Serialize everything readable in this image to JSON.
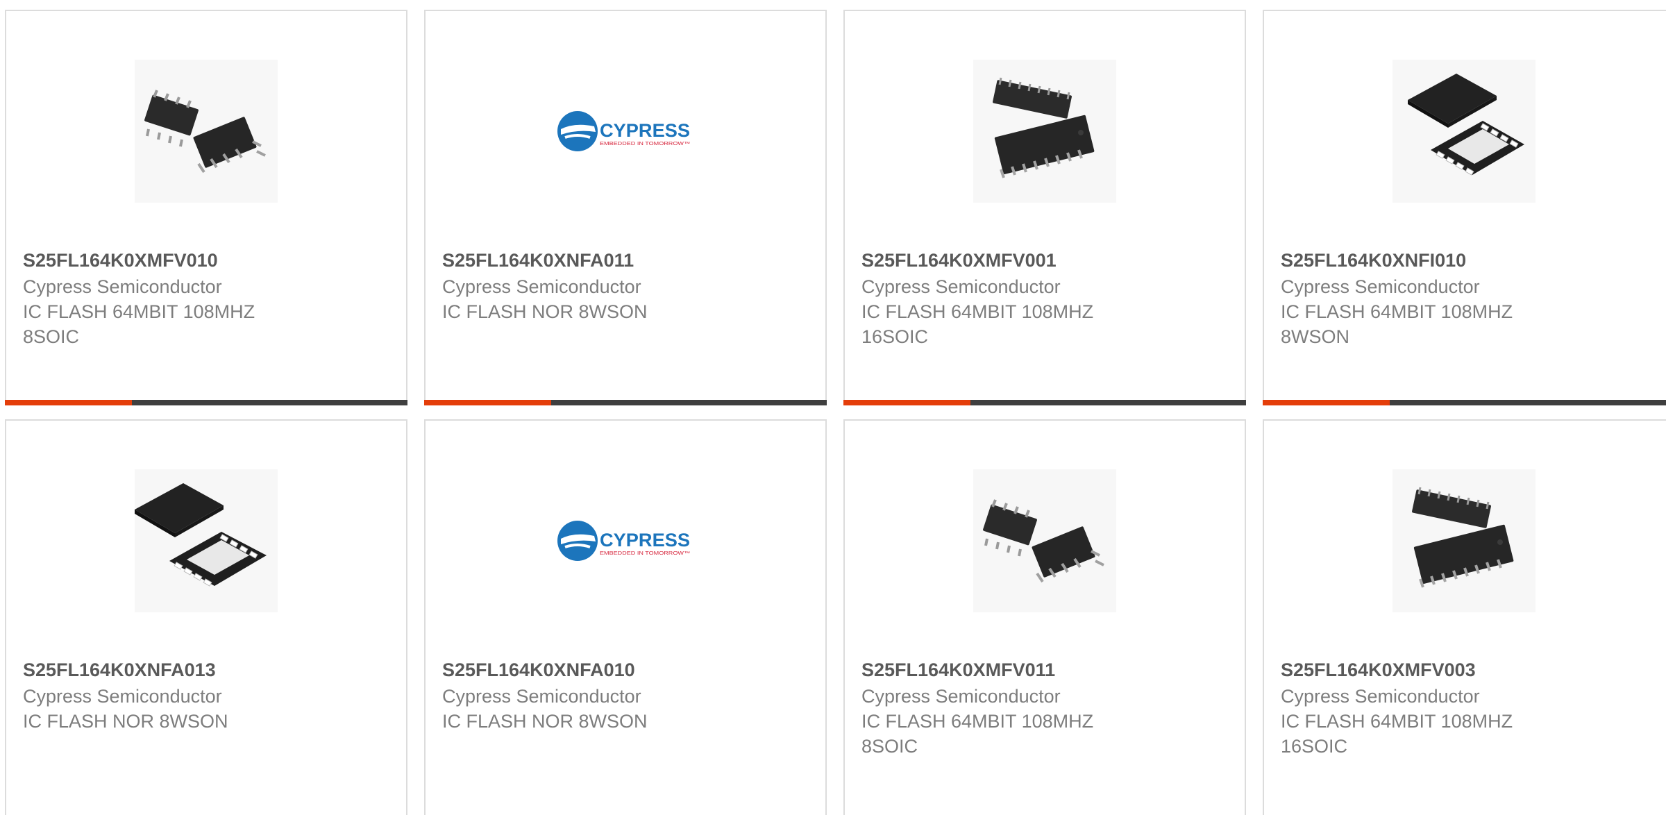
{
  "products": [
    {
      "part_number": "S25FL164K0XMFV010",
      "manufacturer": "Cypress Semiconductor",
      "description": "IC FLASH 64MBIT 108MHZ 8SOIC",
      "image": "chip-8soic-icon"
    },
    {
      "part_number": "S25FL164K0XNFA011",
      "manufacturer": "Cypress Semiconductor",
      "description": "IC FLASH NOR 8WSON",
      "image": "cypress-logo"
    },
    {
      "part_number": "S25FL164K0XMFV001",
      "manufacturer": "Cypress Semiconductor",
      "description": "IC FLASH 64MBIT 108MHZ 16SOIC",
      "image": "chip-16soic-icon"
    },
    {
      "part_number": "S25FL164K0XNFI010",
      "manufacturer": "Cypress Semiconductor",
      "description": "IC FLASH 64MBIT 108MHZ 8WSON",
      "image": "chip-8wson-icon"
    },
    {
      "part_number": "S25FL164K0XNFA013",
      "manufacturer": "Cypress Semiconductor",
      "description": "IC FLASH NOR 8WSON",
      "image": "chip-8wson-icon"
    },
    {
      "part_number": "S25FL164K0XNFA010",
      "manufacturer": "Cypress Semiconductor",
      "description": "IC FLASH NOR 8WSON",
      "image": "cypress-logo"
    },
    {
      "part_number": "S25FL164K0XMFV011",
      "manufacturer": "Cypress Semiconductor",
      "description": "IC FLASH 64MBIT 108MHZ 8SOIC",
      "image": "chip-8soic-icon"
    },
    {
      "part_number": "S25FL164K0XMFV003",
      "manufacturer": "Cypress Semiconductor",
      "description": "IC FLASH 64MBIT 108MHZ 16SOIC",
      "image": "chip-16soic-icon"
    }
  ],
  "logo": {
    "brand": "CYPRESS",
    "tagline": "EMBEDDED IN TOMORROW™"
  },
  "colors": {
    "accent": "#e43e0a",
    "bar": "#3f3f3f",
    "logo_blue": "#1c75bc",
    "logo_red": "#d7263d"
  }
}
